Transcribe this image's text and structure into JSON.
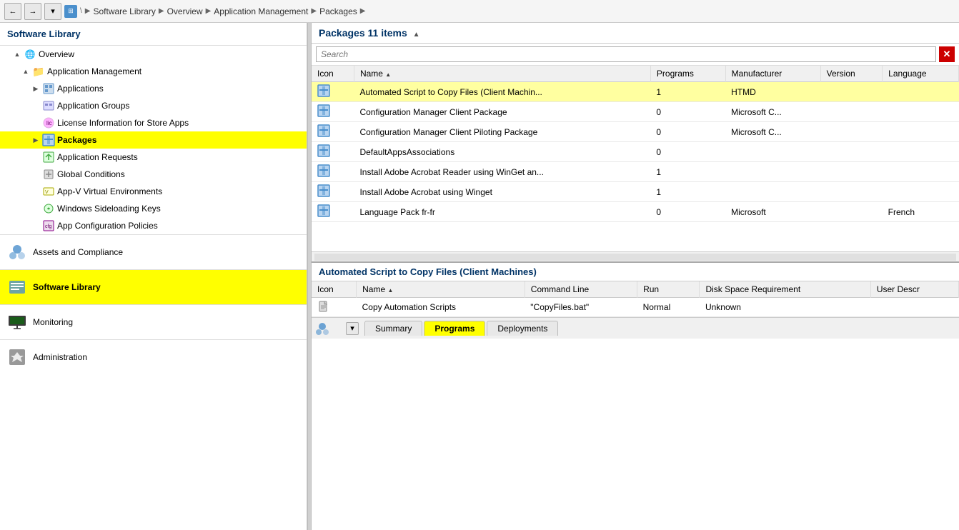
{
  "toolbar": {
    "back_label": "←",
    "forward_label": "→",
    "dropdown_label": "▾",
    "icon_label": "⊞"
  },
  "breadcrumb": {
    "items": [
      {
        "label": "Software Library",
        "sep": "▶"
      },
      {
        "label": "Overview",
        "sep": "▶"
      },
      {
        "label": "Application Management",
        "sep": "▶"
      },
      {
        "label": "Packages",
        "sep": "▶"
      }
    ]
  },
  "sidebar": {
    "title": "Software Library",
    "tree": [
      {
        "id": "overview",
        "label": "Overview",
        "level": 0,
        "icon": "globe",
        "expanded": true
      },
      {
        "id": "app-management",
        "label": "Application Management",
        "level": 1,
        "icon": "folder",
        "expanded": true
      },
      {
        "id": "applications",
        "label": "Applications",
        "level": 2,
        "icon": "app"
      },
      {
        "id": "app-groups",
        "label": "Application Groups",
        "level": 2,
        "icon": "app-groups"
      },
      {
        "id": "license-info",
        "label": "License Information for Store Apps",
        "level": 2,
        "icon": "license"
      },
      {
        "id": "packages",
        "label": "Packages",
        "level": 2,
        "icon": "package",
        "selected": true
      },
      {
        "id": "app-requests",
        "label": "Application Requests",
        "level": 2,
        "icon": "requests"
      },
      {
        "id": "global-conditions",
        "label": "Global Conditions",
        "level": 2,
        "icon": "global"
      },
      {
        "id": "appv",
        "label": "App-V Virtual Environments",
        "level": 2,
        "icon": "appv"
      },
      {
        "id": "sideloading",
        "label": "Windows Sideloading Keys",
        "level": 2,
        "icon": "sideload"
      },
      {
        "id": "app-config",
        "label": "App Configuration Policies",
        "level": 2,
        "icon": "config"
      }
    ],
    "sections": [
      {
        "id": "assets",
        "label": "Assets and Compliance",
        "icon": "assets"
      },
      {
        "id": "software-library",
        "label": "Software Library",
        "icon": "software",
        "active": true
      },
      {
        "id": "monitoring",
        "label": "Monitoring",
        "icon": "monitoring"
      },
      {
        "id": "administration",
        "label": "Administration",
        "icon": "admin"
      }
    ]
  },
  "packages": {
    "title": "Packages",
    "count": "11 items",
    "search_placeholder": "Search",
    "columns": [
      "Icon",
      "Name",
      "Programs",
      "Manufacturer",
      "Version",
      "Language"
    ],
    "rows": [
      {
        "icon": "pkg",
        "name": "Automated Script to Copy Files (Client Machin...",
        "programs": "1",
        "manufacturer": "HTMD",
        "version": "",
        "language": "",
        "highlighted": true,
        "selected": true
      },
      {
        "icon": "pkg",
        "name": "Configuration Manager Client Package",
        "programs": "0",
        "manufacturer": "Microsoft C...",
        "version": "",
        "language": "",
        "highlighted": false,
        "selected": false
      },
      {
        "icon": "pkg",
        "name": "Configuration Manager Client Piloting Package",
        "programs": "0",
        "manufacturer": "Microsoft C...",
        "version": "",
        "language": "",
        "highlighted": false,
        "selected": false
      },
      {
        "icon": "pkg",
        "name": "DefaultAppsAssociations",
        "programs": "0",
        "manufacturer": "",
        "version": "",
        "language": "",
        "highlighted": false,
        "selected": false
      },
      {
        "icon": "pkg",
        "name": "Install Adobe Acrobat Reader using WinGet an...",
        "programs": "1",
        "manufacturer": "",
        "version": "",
        "language": "",
        "highlighted": false,
        "selected": false
      },
      {
        "icon": "pkg",
        "name": "Install Adobe Acrobat using Winget",
        "programs": "1",
        "manufacturer": "",
        "version": "",
        "language": "",
        "highlighted": false,
        "selected": false
      },
      {
        "icon": "pkg",
        "name": "Language Pack fr-fr",
        "programs": "0",
        "manufacturer": "Microsoft",
        "version": "",
        "language": "French",
        "highlighted": false,
        "selected": false
      }
    ]
  },
  "detail": {
    "title": "Automated Script to Copy Files (Client Machines)",
    "columns": [
      "Icon",
      "Name",
      "Command Line",
      "Run",
      "Disk Space Requirement",
      "User Descr"
    ],
    "rows": [
      {
        "icon": "file",
        "name": "Copy Automation Scripts",
        "command_line": "\"CopyFiles.bat\"",
        "run": "Normal",
        "disk_space": "Unknown",
        "user_desc": ""
      }
    ]
  },
  "tabs": [
    {
      "id": "summary",
      "label": "Summary",
      "active": false
    },
    {
      "id": "programs",
      "label": "Programs",
      "active": true
    },
    {
      "id": "deployments",
      "label": "Deployments",
      "active": false
    }
  ]
}
